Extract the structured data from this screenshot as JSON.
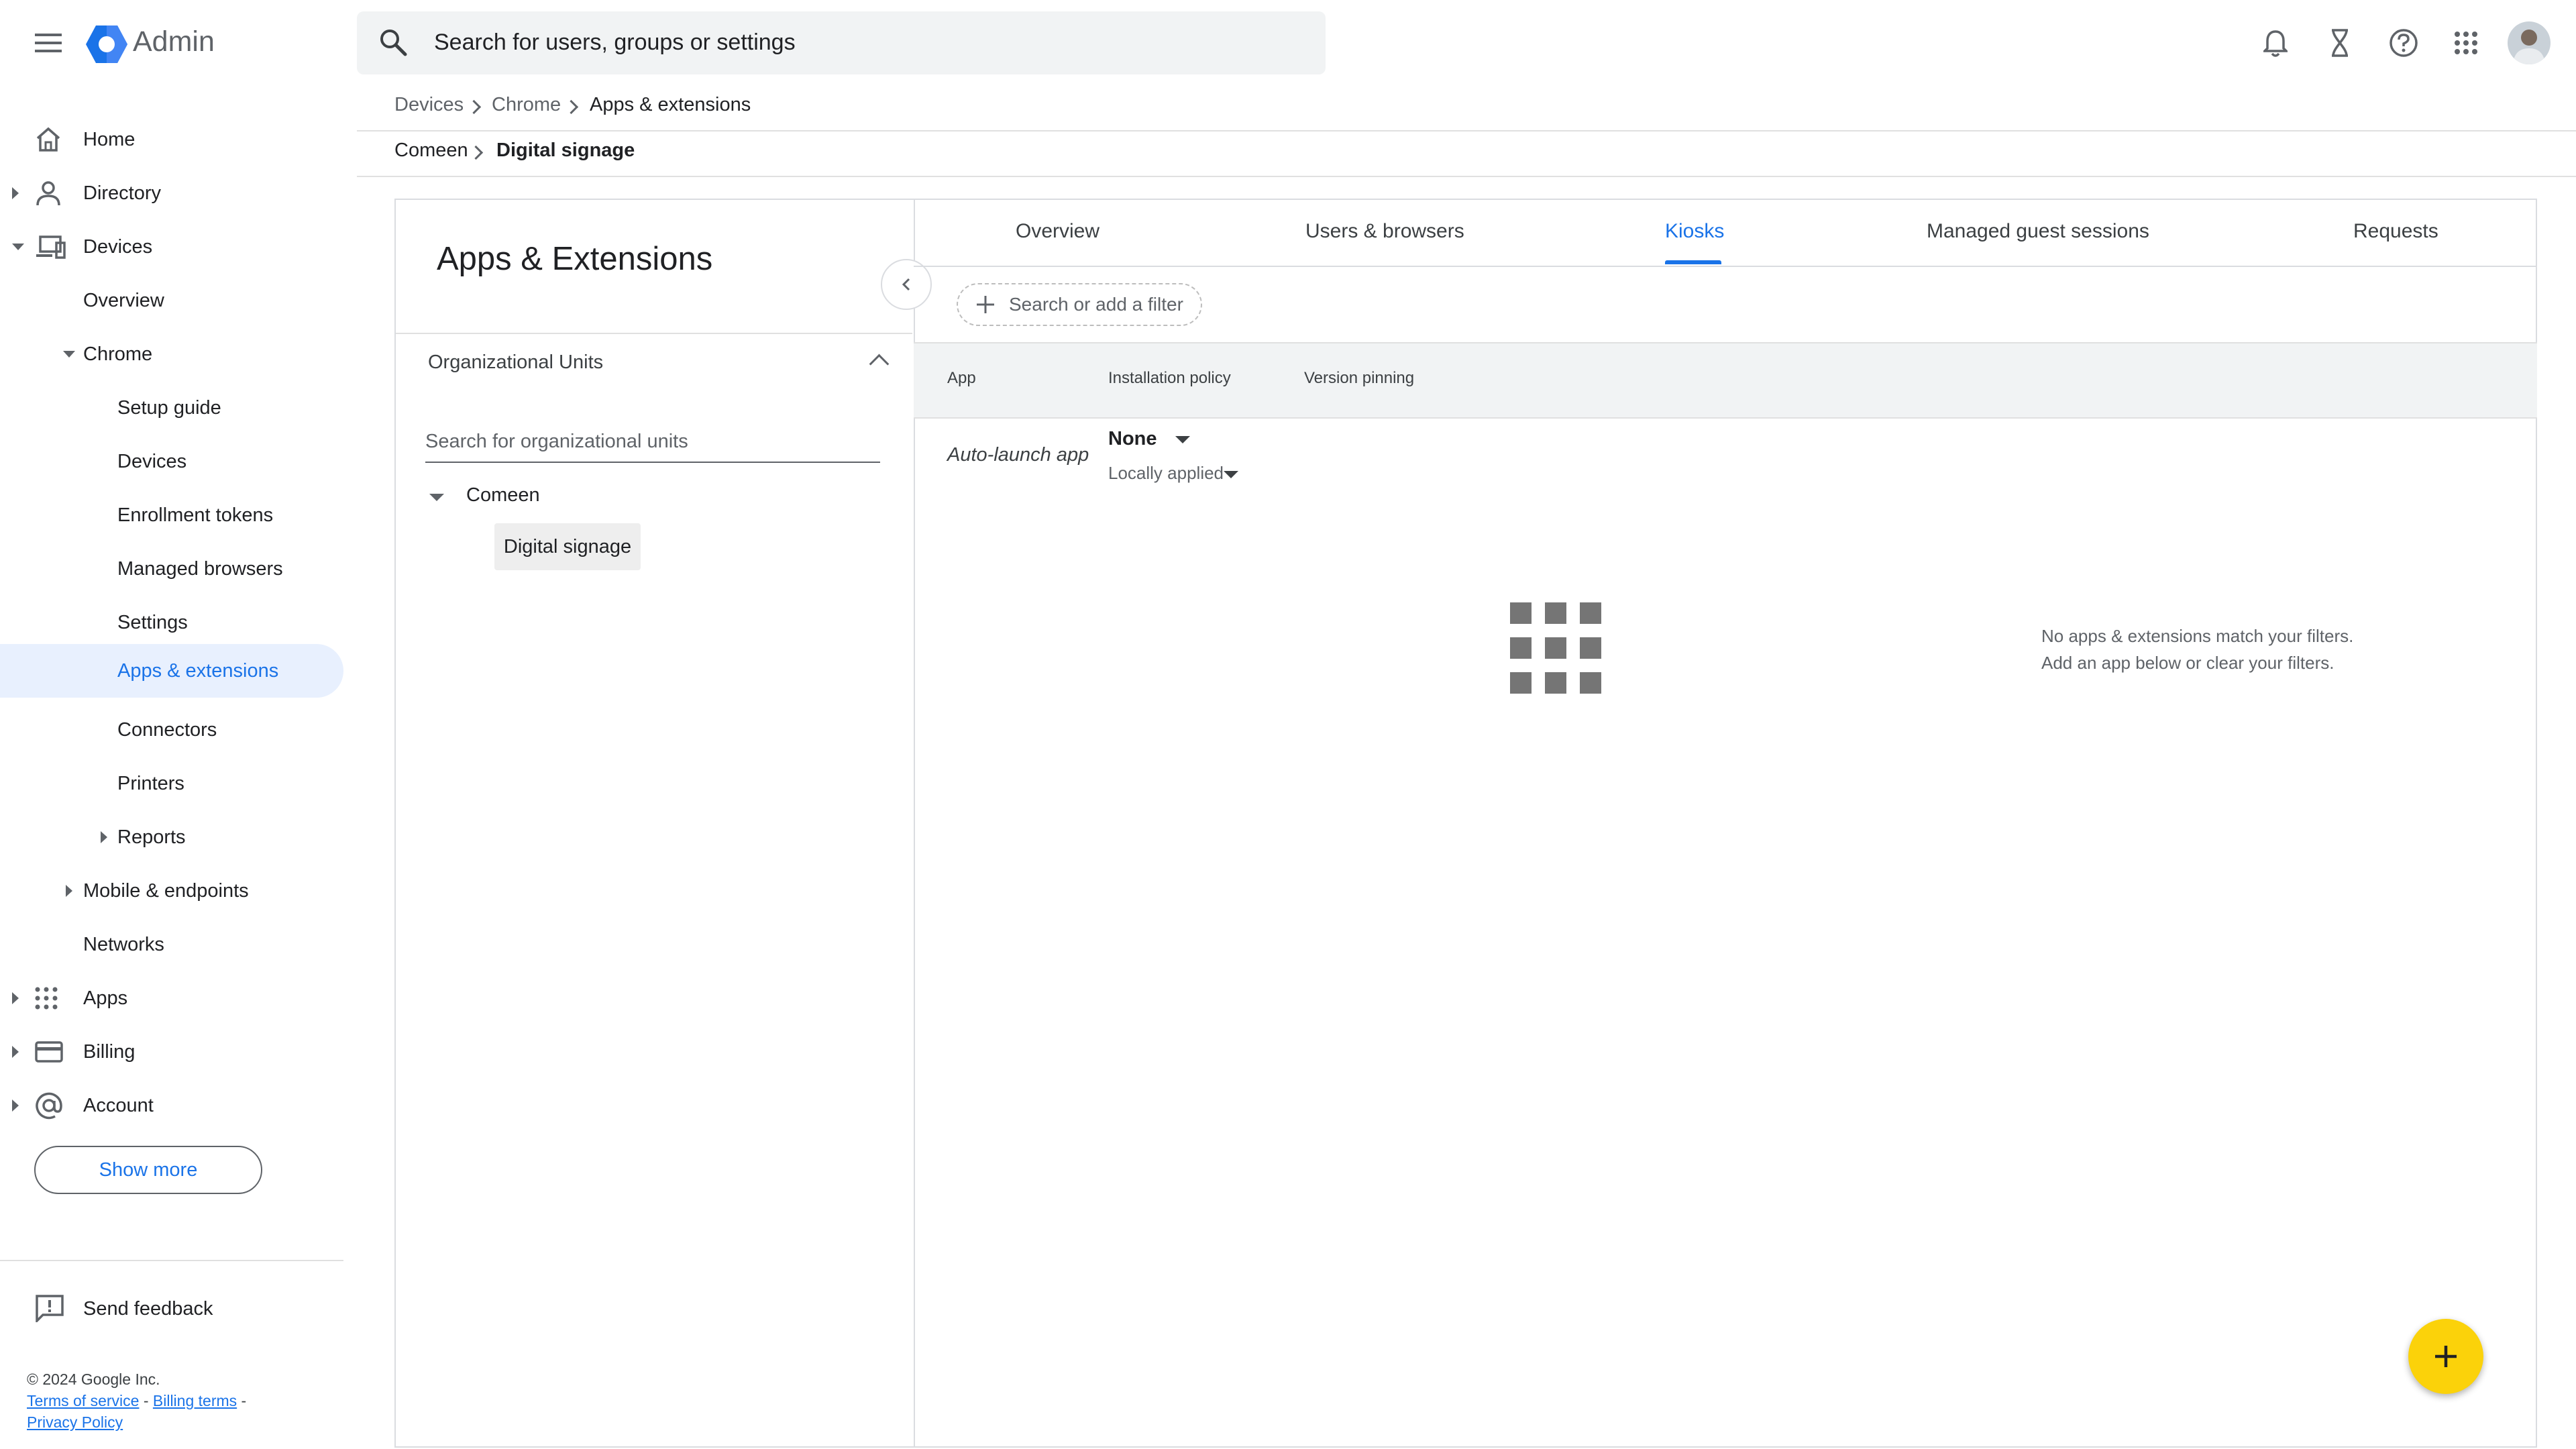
{
  "header": {
    "app_name": "Admin",
    "search_placeholder": "Search for users, groups or settings"
  },
  "sidebar": {
    "items": [
      {
        "label": "Home"
      },
      {
        "label": "Directory"
      },
      {
        "label": "Devices"
      },
      {
        "label": "Overview"
      },
      {
        "label": "Chrome"
      },
      {
        "label": "Setup guide"
      },
      {
        "label": "Devices"
      },
      {
        "label": "Enrollment tokens"
      },
      {
        "label": "Managed browsers"
      },
      {
        "label": "Settings"
      },
      {
        "label": "Apps & extensions"
      },
      {
        "label": "Connectors"
      },
      {
        "label": "Printers"
      },
      {
        "label": "Reports"
      },
      {
        "label": "Mobile & endpoints"
      },
      {
        "label": "Networks"
      },
      {
        "label": "Apps"
      },
      {
        "label": "Billing"
      },
      {
        "label": "Account"
      }
    ],
    "show_more": "Show more",
    "send_feedback": "Send feedback",
    "footer": {
      "copyright": "© 2024 Google Inc.",
      "terms": "Terms of service",
      "billing_terms": "Billing terms",
      "privacy": "Privacy Policy",
      "sep": "-"
    }
  },
  "breadcrumb": {
    "level1": [
      "Devices",
      "Chrome",
      "Apps & extensions"
    ],
    "level2": [
      "Comeen",
      "Digital signage"
    ]
  },
  "left_pane": {
    "title": "Apps & Extensions",
    "ou_header": "Organizational Units",
    "ou_search_placeholder": "Search for organizational units",
    "ou_root": "Comeen",
    "ou_child": "Digital signage"
  },
  "tabs": [
    "Overview",
    "Users & browsers",
    "Kiosks",
    "Managed guest sessions",
    "Requests"
  ],
  "active_tab": "Kiosks",
  "filter_placeholder": "Search or add a filter",
  "table": {
    "columns": [
      "App",
      "Installation policy",
      "Version pinning"
    ],
    "auto_launch_label": "Auto-launch app",
    "policy_value": "None",
    "policy_source": "Locally applied"
  },
  "empty_state": {
    "line1": "No apps & extensions match your filters.",
    "line2": "Add an app below or clear your filters."
  },
  "colors": {
    "accent": "#1a73e8",
    "fab": "#fbd20a",
    "active_nav_bg": "#e8f0fe"
  }
}
